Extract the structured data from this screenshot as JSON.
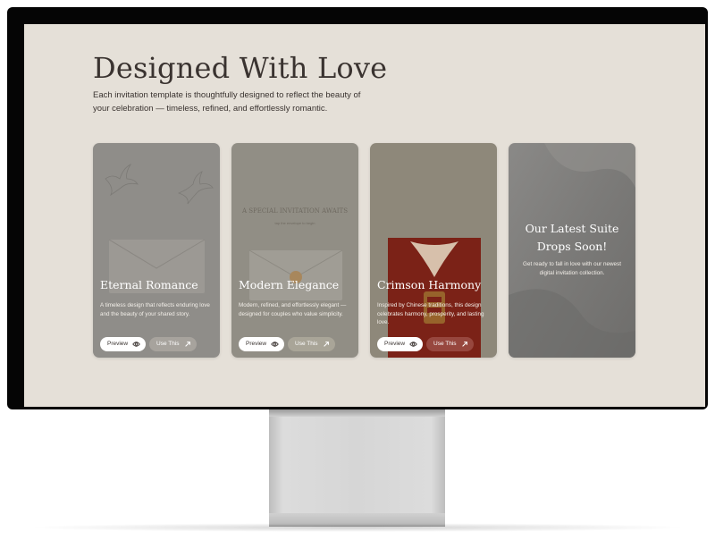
{
  "hero": {
    "title": "Designed With Love",
    "description": "Each invitation template is thoughtfully designed to reflect the beauty of your celebration — timeless, refined, and effortlessly romantic."
  },
  "cards": [
    {
      "title": "Eternal Romance",
      "description": "A timeless design that reflects enduring love and the beauty of your shared story.",
      "preview_label": "Preview",
      "use_label": "Use This"
    },
    {
      "title": "Modern Elegance",
      "description": "Modern, refined, and effortlessly elegant — designed for couples who value simplicity.",
      "preview_label": "Preview",
      "use_label": "Use This",
      "image_text": "A SPECIAL INVITATION AWAITS",
      "image_subtext": "tap the envelope to begin"
    },
    {
      "title": "Crimson Harmony",
      "description": "Inspired by Chinese traditions, this design celebrates harmony, prosperity, and lasting love.",
      "preview_label": "Preview",
      "use_label": "Use This"
    }
  ],
  "promo": {
    "title": "Our Latest Suite Drops Soon!",
    "description": "Get ready to fall in love with our newest digital invitation collection."
  },
  "icons": {
    "preview": "eye-icon",
    "use": "arrow-up-right-icon"
  },
  "colors": {
    "page_background": "#e5e0d8",
    "text_dark": "#3a3330",
    "crimson": "#8c1a14",
    "card_overlay": "#8f8a82"
  }
}
